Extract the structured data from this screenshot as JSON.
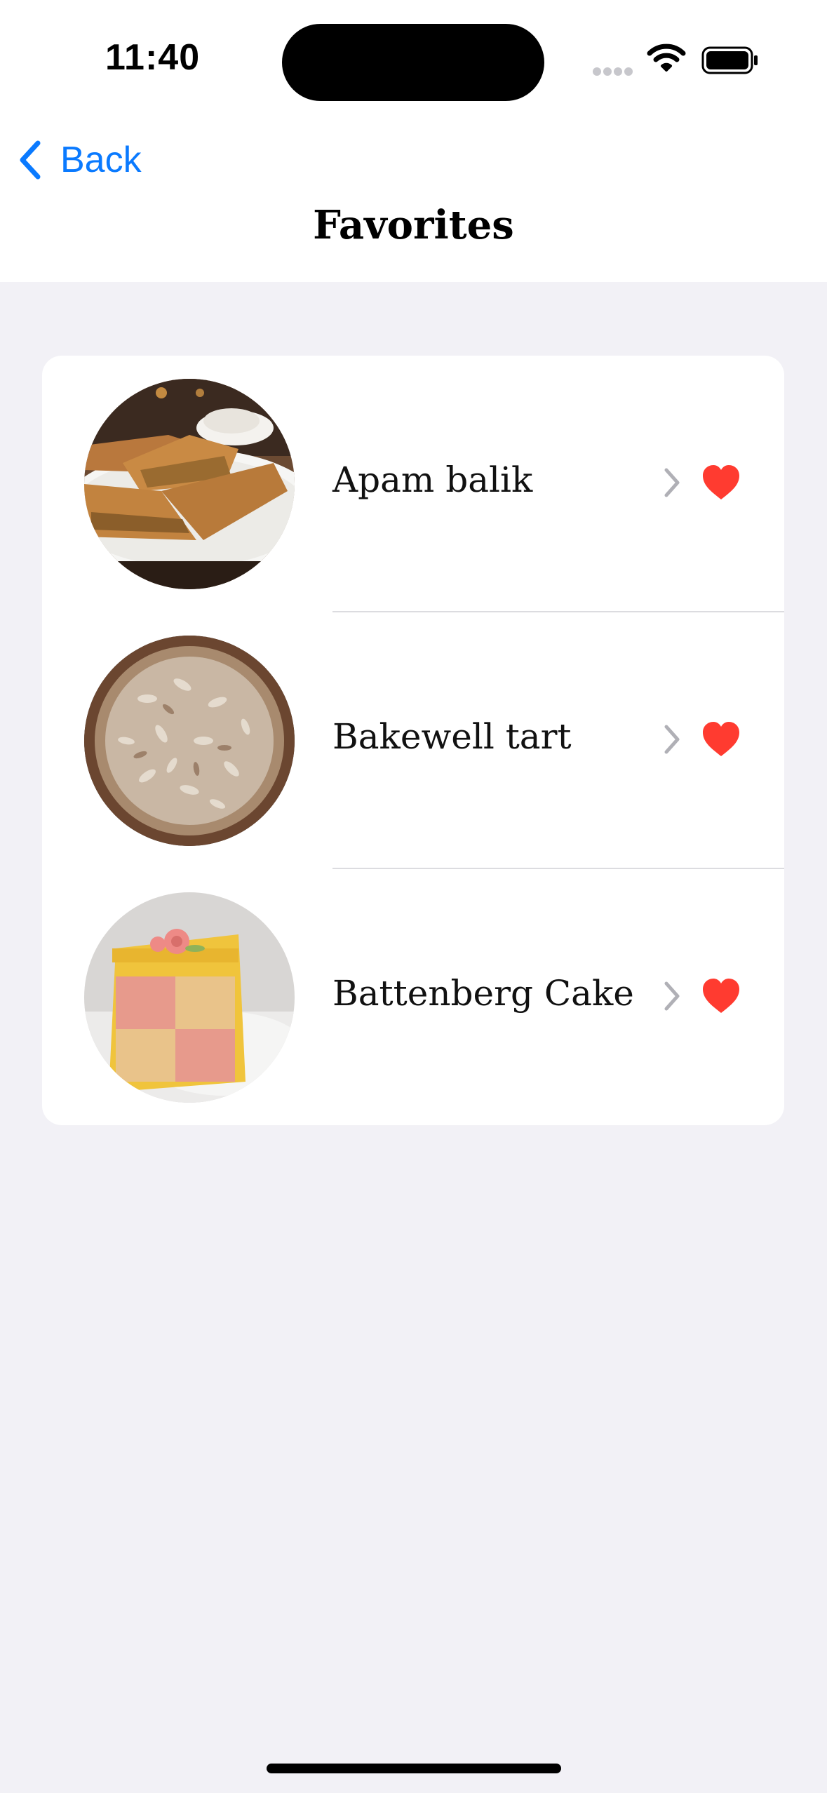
{
  "status_bar": {
    "time": "11:40"
  },
  "nav": {
    "back_label": "Back",
    "title": "Favorites"
  },
  "favorites": [
    {
      "name": "Apam balik",
      "favorited": true,
      "image": "apam-balik-pancake-photo"
    },
    {
      "name": "Bakewell tart",
      "favorited": true,
      "image": "bakewell-tart-photo"
    },
    {
      "name": "Battenberg Cake",
      "favorited": true,
      "image": "battenberg-cake-photo"
    }
  ],
  "colors": {
    "accent": "#0a7aff",
    "heart": "#ff3b30",
    "background": "#f2f1f6"
  }
}
